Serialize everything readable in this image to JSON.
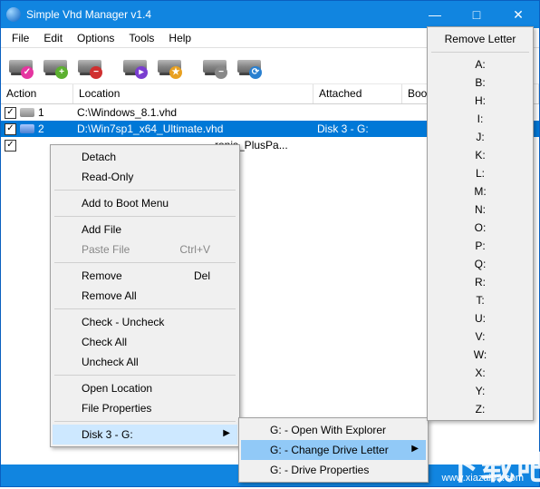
{
  "title": "Simple Vhd Manager v1.4",
  "menu": {
    "file": "File",
    "edit": "Edit",
    "options": "Options",
    "tools": "Tools",
    "help": "Help"
  },
  "headers": {
    "action": "Action",
    "location": "Location",
    "attached": "Attached",
    "boot": "Boo"
  },
  "rows": [
    {
      "num": "1",
      "loc": "C:\\Windows_8.1.vhd",
      "att": "",
      "sel": false,
      "gray": true
    },
    {
      "num": "2",
      "loc": "D:\\Win7sp1_x64_Ultimate.vhd",
      "att": "Disk 3  -  G:",
      "sel": true,
      "gray": false
    },
    {
      "num": "",
      "loc": "ronis_PlusPa...",
      "att": "",
      "sel": false,
      "gray": false,
      "partial": true
    }
  ],
  "ctx1": {
    "detach": "Detach",
    "readonly": "Read-Only",
    "addboot": "Add to Boot Menu",
    "addfile": "Add File",
    "pastefile": "Paste File",
    "paste_sc": "Ctrl+V",
    "remove": "Remove",
    "remove_sc": "Del",
    "removeall": "Remove All",
    "check": "Check - Uncheck",
    "checkall": "Check All",
    "uncheckall": "Uncheck All",
    "openloc": "Open Location",
    "fileprops": "File Properties",
    "disk": "Disk 3  -  G:"
  },
  "ctx2": {
    "open": "G: - Open With Explorer",
    "change": "G: - Change Drive Letter",
    "props": "G: - Drive Properties"
  },
  "ctx3": {
    "title": "Remove Letter",
    "letters": [
      "A:",
      "B:",
      "H:",
      "I:",
      "J:",
      "K:",
      "L:",
      "M:",
      "N:",
      "O:",
      "P:",
      "Q:",
      "R:",
      "T:",
      "U:",
      "V:",
      "W:",
      "X:",
      "Y:",
      "Z:"
    ]
  },
  "watermark": "下载吧",
  "wmurl": "www.xiazaiba.com"
}
